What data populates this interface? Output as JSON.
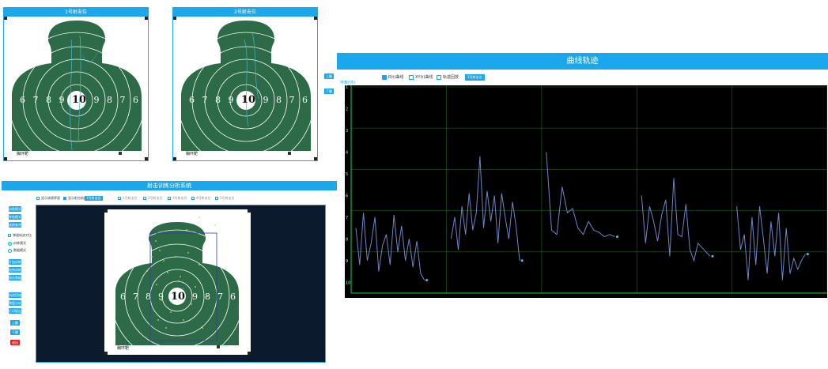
{
  "target1": {
    "title": "1号射击位",
    "caption": "胸环靶",
    "rings": [
      "6",
      "7",
      "8",
      "9",
      "10",
      "9",
      "8",
      "7",
      "6"
    ]
  },
  "target2": {
    "title": "2号射击位",
    "caption": "胸环靶",
    "rings": [
      "6",
      "7",
      "8",
      "9",
      "10",
      "9",
      "8",
      "7",
      "6"
    ]
  },
  "nav": {
    "up": "上翻",
    "down": "下翻"
  },
  "system": {
    "title": "射击训练分析系统",
    "show_score_interface": "显示成绩界面",
    "show_trajectory": "显示射击轨迹",
    "selected_position": "1号射击位",
    "positions": [
      "1号射击位",
      "2号射击位",
      "3号射击位",
      "4号射击位",
      "5号射击位"
    ],
    "left_buttons_top": [
      "训练模式",
      "考核模式",
      "成绩查询"
    ],
    "ballistic_compare": "弹道轨迹对比",
    "training_mode": "训练模式",
    "data_mode": "数据模式",
    "left_buttons_mid": [
      "开始训练",
      "结束训练",
      "保存数据"
    ],
    "left_buttons_low": [
      "轨迹回放",
      "数据分析",
      "打印报告"
    ],
    "up": "上翻",
    "down": "下翻",
    "exit": "退出",
    "target_caption": "胸环靶",
    "rings": [
      "6",
      "7",
      "8",
      "9",
      "10",
      "9",
      "8",
      "7",
      "6"
    ]
  },
  "curve": {
    "title": "曲线轨迹",
    "opt_rt": "R(t)曲线",
    "opt_xy": "XY(t)曲线",
    "opt_replay": "轨迹回放",
    "selected_position": "1号射击位",
    "y_label": "环数(环)",
    "y_ticks": [
      "1",
      "2",
      "3",
      "4",
      "5",
      "6",
      "7",
      "8",
      "9",
      "10"
    ]
  },
  "chart_data": {
    "type": "line",
    "title": "曲线轨迹",
    "ylabel": "环数(环)",
    "ylim": [
      10.5,
      1
    ],
    "grid": true,
    "series": [
      {
        "values": [
          7.5,
          9.2,
          6.8,
          9.0,
          8.2,
          7.0,
          9.5,
          8.3,
          7.8,
          9.2,
          6.9,
          8.6,
          7.4,
          9.0,
          8.0,
          9.3,
          8.1,
          9.6,
          9.9
        ]
      },
      {
        "values": [
          8.0,
          7.0,
          8.5,
          6.5,
          7.8,
          5.9,
          7.6,
          6.8,
          4.2,
          7.5,
          5.8,
          7.2,
          6.0,
          8.2,
          5.9,
          7.0,
          8.0,
          6.3,
          7.4,
          9.0
        ]
      },
      {
        "values": [
          4.0,
          7.6,
          7.8,
          5.6,
          6.8,
          6.6,
          7.5,
          7.8,
          7.2,
          7.6,
          7.7,
          7.9,
          7.8,
          7.9
        ]
      },
      {
        "values": [
          6.0,
          8.2,
          6.5,
          7.2,
          8.1,
          6.9,
          6.2,
          8.8,
          5.2,
          7.8,
          7.9,
          6.4,
          8.5,
          9.0,
          8.2,
          8.4,
          8.6,
          8.8
        ]
      },
      {
        "values": [
          6.5,
          8.5,
          7.8,
          9.9,
          7.0,
          9.2,
          6.5,
          8.0,
          9.6,
          7.2,
          8.8,
          6.8,
          9.9,
          7.5,
          9.6,
          8.9,
          9.4,
          9.0,
          8.7
        ]
      }
    ]
  }
}
